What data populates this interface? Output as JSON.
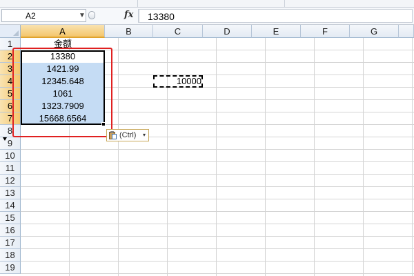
{
  "formula_bar": {
    "name_box": "A2",
    "fx_symbol": "fx",
    "formula": "13380"
  },
  "columns": [
    "A",
    "B",
    "C",
    "D",
    "E",
    "F",
    "G"
  ],
  "rows": [
    "1",
    "2",
    "3",
    "4",
    "5",
    "6",
    "7",
    "8",
    "9",
    "10",
    "11",
    "12",
    "13",
    "14",
    "15",
    "16",
    "17",
    "18",
    "19"
  ],
  "cells": {
    "A1": "金额",
    "A2": "13380",
    "A3": "1421.99",
    "A4": "12345.648",
    "A5": "1061",
    "A6": "1323.7909",
    "A7": "15668.6564",
    "C4": "10000"
  },
  "paste_options": {
    "label": "(Ctrl)",
    "arrow": "▾",
    "icon": "clipboard-icon"
  },
  "colors": {
    "selection_fill": "#c5dcf4",
    "active_header": "#f4c66c",
    "annotation_red": "#e02020"
  }
}
